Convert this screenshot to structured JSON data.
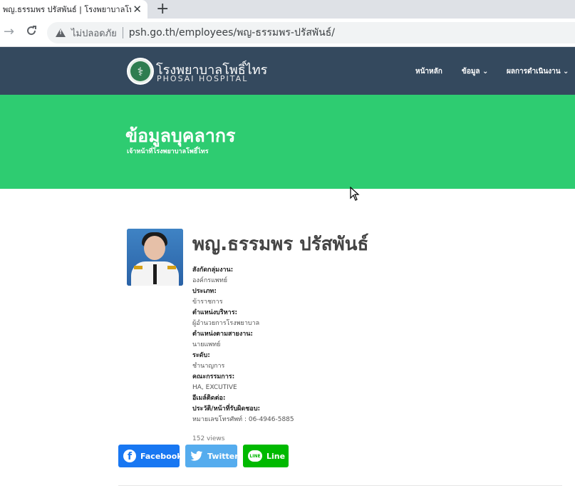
{
  "browser": {
    "tab_title": "พญ.ธรรมพร ปรัสพันธ์ | โรงพยาบาลโพ",
    "close_glyph": "✕",
    "new_tab_glyph": "+",
    "back_glyph": "→",
    "reload_glyph": "C",
    "insecure_label": "ไม่ปลอดภัย",
    "url": "psh.go.th/employees/พญ-ธรรมพร-ปรัสพันธ์/"
  },
  "header": {
    "logo_th": "โรงพยาบาลโพธิ์ไทร",
    "logo_en": "PHOSAI HOSPITAL",
    "nav": {
      "home": "หน้าหลัก",
      "info": "ข้อมูล ⌄",
      "performance": "ผลการดำเนินงาน ⌄"
    }
  },
  "banner": {
    "title": "ข้อมูลบุคลากร",
    "subtitle": "เจ้าหน้าที่โรงพยาบาลโพธิ์ไทร"
  },
  "profile": {
    "name": "พญ.ธรรมพร ปรัสพันธ์",
    "fields": [
      {
        "label": "สังกัดกลุ่มงาน:",
        "value": "องค์กรแพทย์"
      },
      {
        "label": "ประเภท:",
        "value": "ข้าราชการ"
      },
      {
        "label": "ตำแหน่งบริหาร:",
        "value": "ผู้อำนวยการโรงพยาบาล"
      },
      {
        "label": "ตำแหน่งตามสายงาน:",
        "value": "นายแพทย์"
      },
      {
        "label": "ระดับ:",
        "value": "ชำนาญการ"
      },
      {
        "label": "คณะกรรมการ:",
        "value": "HA, EXCUTIVE"
      },
      {
        "label": "อีเมล์ติดต่อ:",
        "value": ""
      },
      {
        "label": "ประวัติ/หน้าที่รับผิดชอบ:",
        "value": "หมายเลขโทรศัพท์ : 06-4946-5885"
      }
    ],
    "views": "152 views"
  },
  "share": {
    "facebook": "Facebook",
    "twitter": "Twitter",
    "line": "Line",
    "facebook_glyph": "f",
    "line_glyph": "LINE"
  },
  "colors": {
    "header_bg": "#34495e",
    "banner_bg": "#2ecc71",
    "facebook": "#1877f2",
    "twitter": "#55acee",
    "line": "#00b900"
  },
  "icons": [
    "warning-icon",
    "back-icon",
    "reload-icon",
    "close-icon",
    "plus-icon",
    "logo-icon",
    "facebook-icon",
    "twitter-icon",
    "line-icon",
    "cursor-icon"
  ]
}
